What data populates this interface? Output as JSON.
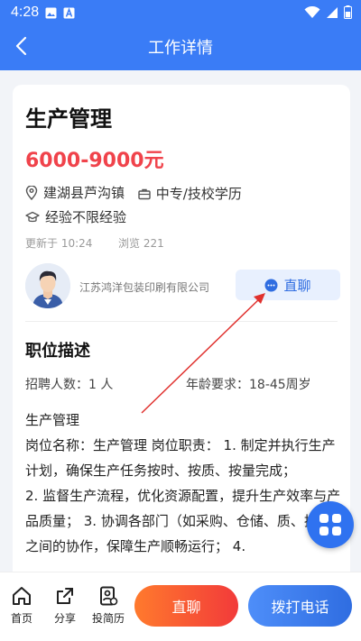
{
  "status_bar": {
    "time": "4:28",
    "icons": [
      "image-icon",
      "a-icon",
      "wifi-icon",
      "signal-icon",
      "battery-icon"
    ]
  },
  "header": {
    "title": "工作详情",
    "back_icon": "chevron-left-icon",
    "background": "#3a7cf6"
  },
  "job": {
    "title": "生产管理",
    "salary": "6000-9000元",
    "location": "建湖县芦沟镇",
    "education": "中专/技校学历",
    "experience": "经验不限经验",
    "updated": "更新于 10:24",
    "views": "浏览 221"
  },
  "company": {
    "name": "江苏鸿洋包装印刷有限公司",
    "chat_label": "直聊"
  },
  "description": {
    "section_title": "职位描述",
    "headcount": "招聘人数：1 人",
    "age": "年龄要求：18-45周岁",
    "body": "生产管理\n岗位名称：生产管理 岗位职责： 1. 制定并执行生产计划，确保生产任务按时、按质、按量完成；\n2. 监督生产流程，优化资源配置，提升生产效率与产品质量； 3. 协调各部门（如采购、仓储、质、技术）之间的协作，保障生产顺畅运行； 4."
  },
  "bottom_bar": {
    "tabs": [
      {
        "label": "首页",
        "icon": "home-icon"
      },
      {
        "label": "分享",
        "icon": "share-icon"
      },
      {
        "label": "投简历",
        "icon": "resume-icon"
      }
    ],
    "chat_button": "直聊",
    "call_button": "拨打电话"
  },
  "colors": {
    "primary": "#3a7cf6",
    "salary": "#f0434b",
    "chat_gradient_start": "#ff7a2d",
    "chat_gradient_end": "#f23a3a"
  }
}
